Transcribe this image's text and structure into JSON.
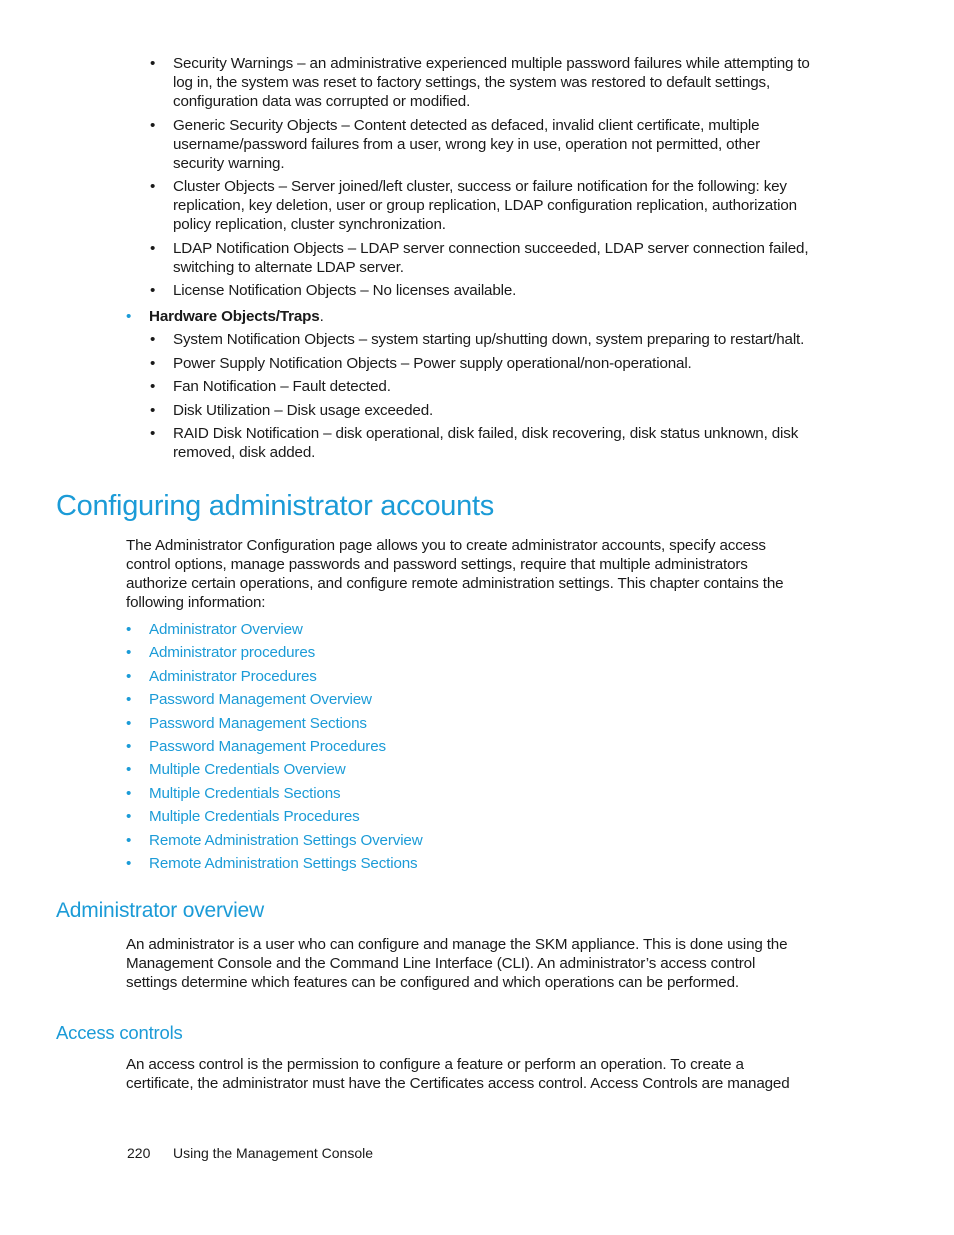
{
  "security_items": [
    "Security Warnings – an administrative experienced multiple password failures while attempting to log in, the system was reset to factory settings, the system was restored to default settings, configuration data was corrupted or modified.",
    "Generic Security Objects – Content detected as defaced, invalid client certificate, multiple username/password failures from a user, wrong key in use, operation not permitted, other security warning.",
    "Cluster Objects – Server joined/left cluster, success or failure notification for the following: key replication, key deletion, user or group replication, LDAP configuration replication, authorization policy replication, cluster synchronization.",
    "LDAP Notification Objects – LDAP server connection succeeded, LDAP server connection failed, switching to alternate LDAP server.",
    "License Notification Objects – No licenses available."
  ],
  "hardware": {
    "label": "Hardware Objects/Traps",
    "period": ".",
    "items": [
      "System Notification Objects – system starting up/shutting down, system preparing to restart/halt.",
      "Power Supply Notification Objects – Power supply operational/non-operational.",
      "Fan Notification – Fault detected.",
      "Disk Utilization – Disk usage exceeded.",
      "RAID Disk Notification – disk operational, disk failed, disk recovering, disk status unknown, disk removed, disk added."
    ]
  },
  "bullet_char": "•",
  "section_title": "Configuring administrator accounts",
  "section_intro": "The Administrator Configuration page allows you to create administrator accounts, specify access control options, manage passwords and password settings, require that multiple administrators authorize certain operations, and configure remote administration settings. This chapter contains the following information:",
  "links": [
    "Administrator Overview",
    "Administrator procedures",
    "Administrator Procedures",
    "Password Management Overview",
    "Password Management Sections",
    "Password Management Procedures",
    "Multiple Credentials Overview",
    "Multiple Credentials Sections",
    "Multiple Credentials Procedures",
    "Remote Administration Settings Overview",
    "Remote Administration Settings Sections"
  ],
  "admin_overview": {
    "title": "Administrator overview",
    "body": "An administrator is a user who can configure and manage the SKM appliance. This is done using the Management Console and the Command Line Interface (CLI). An administrator’s access control settings determine which features can be configured and which operations can be performed."
  },
  "access_controls": {
    "title": "Access controls",
    "body": "An access control is the permission to configure a feature or perform an operation. To create a certificate, the administrator must have the Certificates access control. Access Controls are managed"
  },
  "footer": {
    "page_number": "220",
    "chapter": "Using the Management Console"
  },
  "colors": {
    "accent": "#1b9bd7",
    "text": "#1a1a1a"
  }
}
